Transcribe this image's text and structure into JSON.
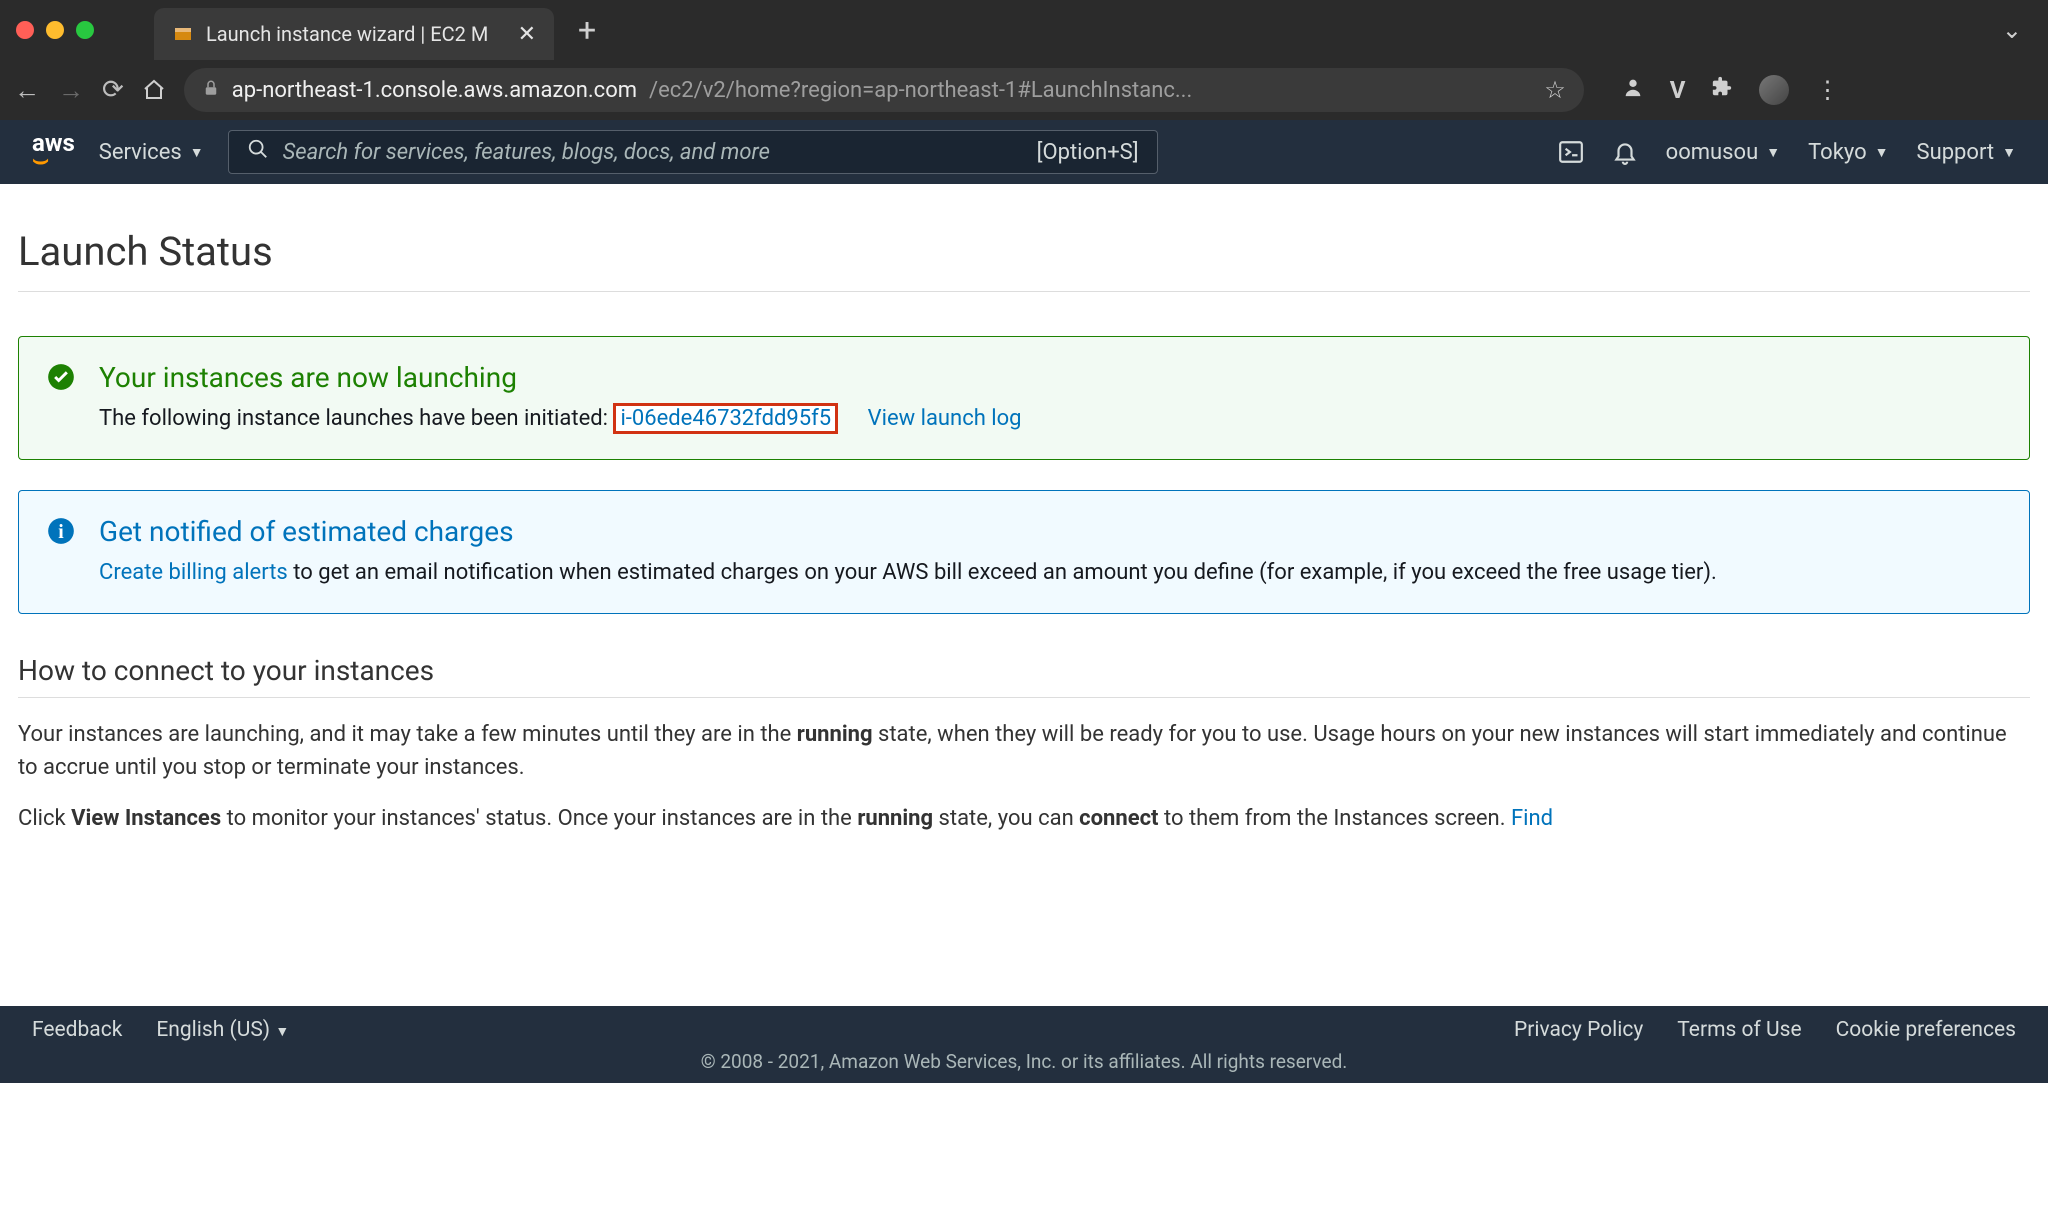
{
  "browser": {
    "tab_title": "Launch instance wizard | EC2 M",
    "url_host": "ap-northeast-1.console.aws.amazon.com",
    "url_path": "/ec2/v2/home?region=ap-northeast-1#LaunchInstanc..."
  },
  "aws_nav": {
    "services": "Services",
    "search_placeholder": "Search for services, features, blogs, docs, and more",
    "search_hint": "[Option+S]",
    "user": "oomusou",
    "region": "Tokyo",
    "support": "Support"
  },
  "page": {
    "title": "Launch Status",
    "success_alert": {
      "title": "Your instances are now launching",
      "text": "The following instance launches have been initiated:",
      "instance_id": "i-06ede46732fdd95f5",
      "view_log": "View launch log"
    },
    "info_alert": {
      "title": "Get notified of estimated charges",
      "link": "Create billing alerts",
      "text_after": " to get an email notification when estimated charges on your AWS bill exceed an amount you define (for example, if you exceed the free usage tier)."
    },
    "connect_section": {
      "title": "How to connect to your instances",
      "p1_a": "Your instances are launching, and it may take a few minutes until they are in the ",
      "p1_b": "running",
      "p1_c": " state, when they will be ready for you to use. Usage hours on your new instances will start immediately and continue to accrue until you stop or terminate your instances.",
      "p2_a": "Click ",
      "p2_b": "View Instances",
      "p2_c": " to monitor your instances' status. Once your instances are in the ",
      "p2_d": "running",
      "p2_e": " state, you can ",
      "p2_f": "connect",
      "p2_g": " to them from the Instances screen.  ",
      "p2_link": "Find"
    }
  },
  "footer": {
    "feedback": "Feedback",
    "language": "English (US)",
    "privacy": "Privacy Policy",
    "terms": "Terms of Use",
    "cookie": "Cookie preferences",
    "copyright": "© 2008 - 2021, Amazon Web Services, Inc. or its affiliates. All rights reserved."
  }
}
